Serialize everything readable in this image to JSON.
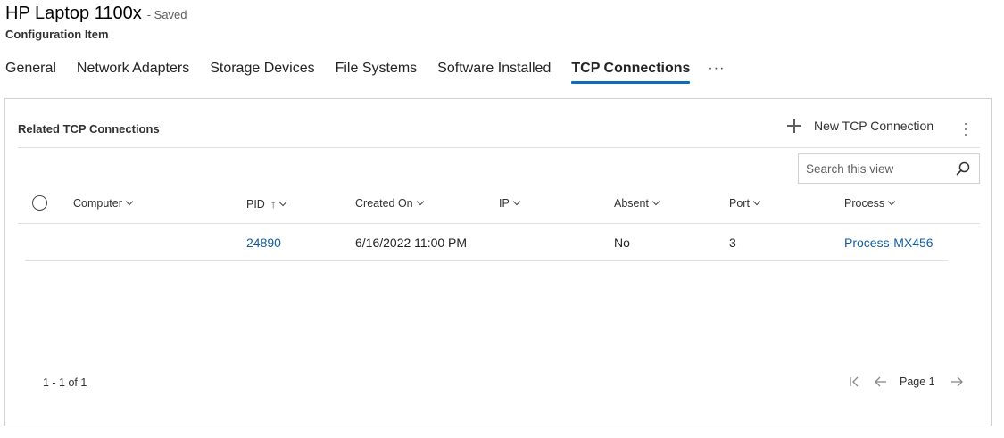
{
  "header": {
    "title": "HP Laptop 1100x",
    "saved": "- Saved",
    "subtitle": "Configuration Item"
  },
  "tabs": [
    {
      "label": "General",
      "active": false
    },
    {
      "label": "Network Adapters",
      "active": false
    },
    {
      "label": "Storage Devices",
      "active": false
    },
    {
      "label": "File Systems",
      "active": false
    },
    {
      "label": "Software Installed",
      "active": false
    },
    {
      "label": "TCP Connections",
      "active": true
    }
  ],
  "tab_more": "···",
  "grid": {
    "title": "Related TCP Connections",
    "new_button": "New TCP Connection",
    "search_placeholder": "Search this view",
    "columns": [
      "Computer",
      "PID",
      "Created On",
      "IP",
      "Absent",
      "Port",
      "Process"
    ],
    "rows": [
      {
        "computer": "",
        "pid": "24890",
        "created_on": "6/16/2022 11:00 PM",
        "ip": "",
        "absent": "No",
        "port": "3",
        "process": "Process-MX456"
      }
    ],
    "record_count": "1 - 1 of 1",
    "page_label": "Page 1"
  },
  "icons": {
    "plus": "plus-icon",
    "more": "more-vertical-icon",
    "search": "search-icon",
    "sort": "sort-ascending-icon",
    "first_page": "first-page-icon",
    "prev_page": "previous-page-icon",
    "next_page": "next-page-icon"
  },
  "colors": {
    "accent": "#0f6cbd",
    "link": "#115ea3"
  }
}
